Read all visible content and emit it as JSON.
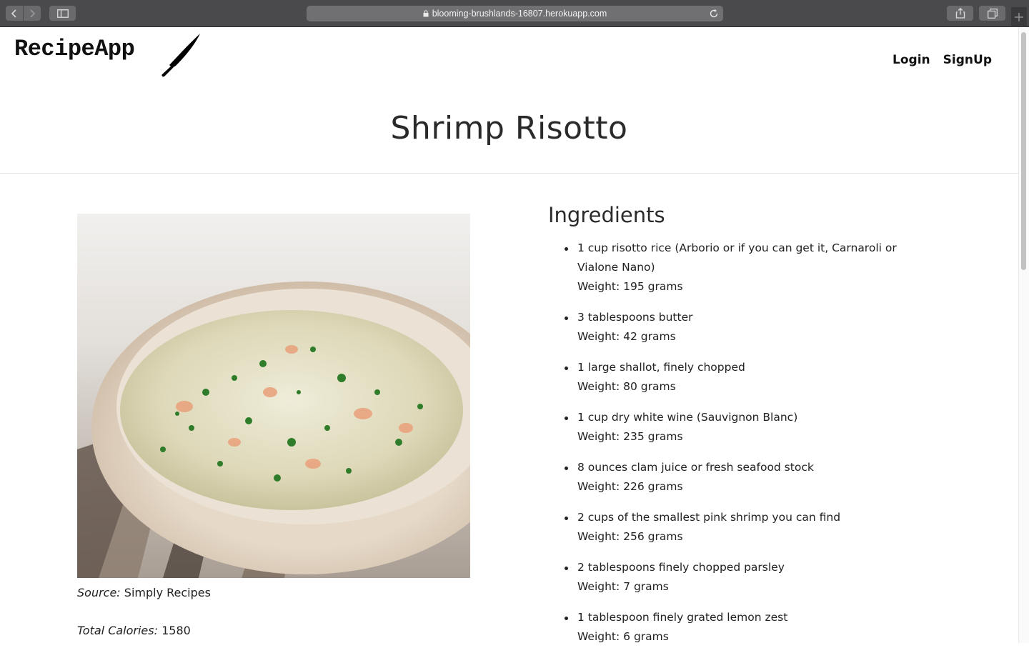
{
  "browser": {
    "url": "blooming-brushlands-16807.herokuapp.com"
  },
  "header": {
    "logo_text": "RecipeApp",
    "logo_icon": "knife-icon",
    "nav": [
      {
        "label": "Login"
      },
      {
        "label": "SignUp"
      }
    ]
  },
  "recipe": {
    "title": "Shrimp Risotto",
    "image_alt": "Shrimp risotto in a bowl",
    "source_label": "Source:",
    "source_value": "Simply Recipes",
    "calories_label": "Total Calories:",
    "calories_value": "1580"
  },
  "ingredients": {
    "heading": "Ingredients",
    "items": [
      {
        "text": "1 cup risotto rice (Arborio or if you can get it, Carnaroli or Vialone Nano)",
        "weight": "Weight: 195 grams"
      },
      {
        "text": "3 tablespoons butter",
        "weight": "Weight: 42 grams"
      },
      {
        "text": "1 large shallot, finely chopped",
        "weight": "Weight: 80 grams"
      },
      {
        "text": "1 cup dry white wine (Sauvignon Blanc)",
        "weight": "Weight: 235 grams"
      },
      {
        "text": "8 ounces clam juice or fresh seafood stock",
        "weight": "Weight: 226 grams"
      },
      {
        "text": "2 cups of the smallest pink shrimp you can find",
        "weight": "Weight: 256 grams"
      },
      {
        "text": "2 tablespoons finely chopped parsley",
        "weight": "Weight: 7 grams"
      },
      {
        "text": "1 tablespoon finely grated lemon zest",
        "weight": "Weight: 6 grams"
      }
    ]
  }
}
